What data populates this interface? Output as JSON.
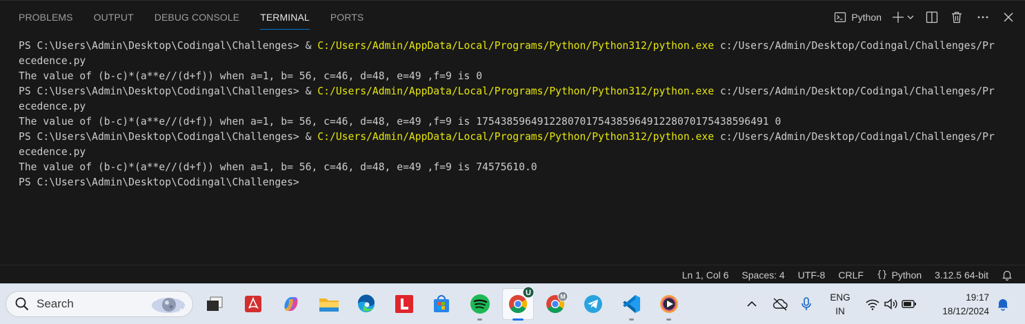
{
  "panel": {
    "tabs": [
      {
        "label": "PROBLEMS",
        "active": false
      },
      {
        "label": "OUTPUT",
        "active": false
      },
      {
        "label": "DEBUG CONSOLE",
        "active": false
      },
      {
        "label": "TERMINAL",
        "active": true
      },
      {
        "label": "PORTS",
        "active": false
      }
    ],
    "terminal_name": "Python",
    "icons": [
      "terminal-icon",
      "plus-icon",
      "chevron-down-icon",
      "split-terminal-icon",
      "trash-icon",
      "more-icon",
      "close-icon"
    ]
  },
  "terminal": {
    "lines": [
      {
        "prompt": "PS C:\\Users\\Admin\\Desktop\\Codingal\\Challenges> ",
        "amp": "& ",
        "exe": "C:/Users/Admin/AppData/Local/Programs/Python/Python312/python.exe",
        "arg": " c:/Users/Admin/Desktop/Codingal/Challenges/Pr"
      },
      {
        "text": "ecedence.py"
      },
      {
        "text": "The value of (b-c)*(a**e//(d+f)) when a=1, b= 56, c=46, d=48, e=49 ,f=9 is 0"
      },
      {
        "prompt": "PS C:\\Users\\Admin\\Desktop\\Codingal\\Challenges> ",
        "amp": "& ",
        "exe": "C:/Users/Admin/AppData/Local/Programs/Python/Python312/python.exe",
        "arg": " c:/Users/Admin/Desktop/Codingal/Challenges/Pr"
      },
      {
        "text": "ecedence.py"
      },
      {
        "text": "The value of (b-c)*(a**e//(d+f)) when a=1, b= 56, c=46, d=48, e=49 ,f=9 is 175438596491228070175438596491228070175438596491 0"
      },
      {
        "prompt": "PS C:\\Users\\Admin\\Desktop\\Codingal\\Challenges> ",
        "amp": "& ",
        "exe": "C:/Users/Admin/AppData/Local/Programs/Python/Python312/python.exe",
        "arg": " c:/Users/Admin/Desktop/Codingal/Challenges/Pr"
      },
      {
        "text": "ecedence.py"
      },
      {
        "text": "The value of (b-c)*(a**e//(d+f)) when a=1, b= 56, c=46, d=48, e=49 ,f=9 is 74575610.0"
      },
      {
        "text": "PS C:\\Users\\Admin\\Desktop\\Codingal\\Challenges>"
      }
    ],
    "colors": {
      "path": "#e5e510",
      "text": "#cccccc",
      "background": "#181818"
    }
  },
  "statusbar": {
    "items": [
      {
        "label": "Ln 1, Col 6",
        "name": "cursor-position"
      },
      {
        "label": "Spaces: 4",
        "name": "indentation"
      },
      {
        "label": "UTF-8",
        "name": "encoding"
      },
      {
        "label": "CRLF",
        "name": "line-ending"
      },
      {
        "label": "Python",
        "name": "language-mode",
        "prefix": "{}"
      },
      {
        "label": "3.12.5 64-bit",
        "name": "python-interpreter"
      }
    ]
  },
  "taskbar": {
    "search_label": "Search",
    "apps": [
      "task-view-icon",
      "pdf-reader-icon",
      "copilot-icon",
      "file-explorer-icon",
      "edge-icon",
      "l-app-icon",
      "store-icon",
      "spotify-icon",
      "chrome-icon",
      "chrome-profile-icon",
      "telegram-icon",
      "vscode-icon",
      "media-player-icon"
    ],
    "chrome_badge": "U",
    "chrome_profile_badge": "M",
    "lang_top": "ENG",
    "lang_bottom": "IN",
    "time": "19:17",
    "date": "18/12/2024"
  }
}
